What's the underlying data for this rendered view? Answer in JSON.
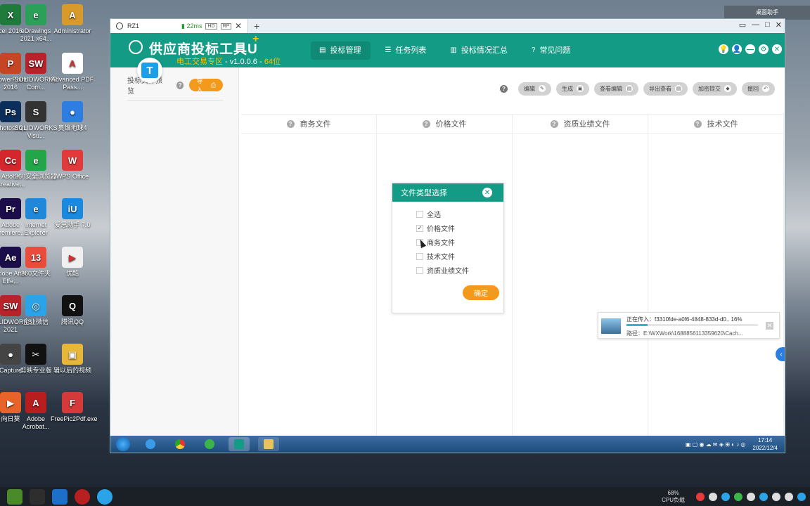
{
  "desktop": {
    "icons": [
      {
        "label": "cel 2016",
        "color": "#1e7b3c",
        "glyph": "X"
      },
      {
        "label": "eDrawings 2021 x64...",
        "color": "#2aa058",
        "glyph": "e"
      },
      {
        "label": "Administrator",
        "color": "#d89b2b",
        "glyph": "A"
      },
      {
        "label": "PowerPoint 2016",
        "color": "#c64524",
        "glyph": "P"
      },
      {
        "label": "SOLIDWORKS Com...",
        "color": "#b8222b",
        "glyph": "SW"
      },
      {
        "label": "Advanced PDF Pass...",
        "color": "#ffffff",
        "glyph": "A"
      },
      {
        "label": "Photoshop",
        "color": "#0b2e5b",
        "glyph": "Ps"
      },
      {
        "label": "SOLIDWORKS Visu...",
        "color": "#333333",
        "glyph": "S"
      },
      {
        "label": "奥维地球4",
        "color": "#2e7de0",
        "glyph": "●"
      },
      {
        "label": "Adobe Creative...",
        "color": "#d4262d",
        "glyph": "Cc"
      },
      {
        "label": "360安全浏览器",
        "color": "#23a54a",
        "glyph": "e"
      },
      {
        "label": "WPS Office",
        "color": "#e23a3a",
        "glyph": "W"
      },
      {
        "label": "Adobe Premiere...",
        "color": "#1b0d4a",
        "glyph": "Pr"
      },
      {
        "label": "Internet Explorer",
        "color": "#1f88d8",
        "glyph": "e"
      },
      {
        "label": "爱思助手 7.0",
        "color": "#1a8ae0",
        "glyph": "iU"
      },
      {
        "label": "Adobe After Effe...",
        "color": "#1b0d4a",
        "glyph": "Ae"
      },
      {
        "label": "360文件夹",
        "color": "#e94b3c",
        "glyph": "13"
      },
      {
        "label": "优酷",
        "color": "#f0f0f0",
        "glyph": "▶"
      },
      {
        "label": "SOLIDWORKS 2021",
        "color": "#b8222b",
        "glyph": "SW"
      },
      {
        "label": "企业微信",
        "color": "#2aa3e8",
        "glyph": "◎"
      },
      {
        "label": "腾讯QQ",
        "color": "#111111",
        "glyph": "Q"
      },
      {
        "label": "Capture",
        "color": "#444444",
        "glyph": "●"
      },
      {
        "label": "剪映专业版",
        "color": "#111111",
        "glyph": "✂"
      },
      {
        "label": "辑以后的视频",
        "color": "#e8b73a",
        "glyph": "▣"
      },
      {
        "label": "向日葵",
        "color": "#e8632a",
        "glyph": "▶"
      },
      {
        "label": "Adobe Acrobat...",
        "color": "#b81e1e",
        "glyph": "A"
      },
      {
        "label": "FreePic2Pdf.exe",
        "color": "#d43a3a",
        "glyph": "F"
      }
    ],
    "right_panel_label": "桌面助手"
  },
  "host_taskbar": {
    "cpu_percent": "68%",
    "cpu_label": "CPU负载"
  },
  "remote_window": {
    "tab_label": "RZ1",
    "latency": "22ms",
    "badge_hd": "HD",
    "badge_rp": "RP",
    "close_glyph": "✕",
    "plus_glyph": "+",
    "ctrls": [
      "▭",
      "—",
      "□",
      "✕"
    ]
  },
  "app": {
    "title": "供应商投标工具U",
    "title_plus": "+",
    "subtitle_zone": "电工交易专区",
    "subtitle_version": " - v1.0.0.6 - ",
    "subtitle_bits": "64位",
    "nav": [
      {
        "label": "投标管理",
        "icon": "▤"
      },
      {
        "label": "任务列表",
        "icon": "☰"
      },
      {
        "label": "投标情况汇总",
        "icon": "▥"
      },
      {
        "label": "常见问题",
        "icon": "?"
      }
    ],
    "header_icons": [
      "💡",
      "👤",
      "—",
      "⚙",
      "✕"
    ],
    "left_panel": {
      "label": "投标文件预览",
      "import_label": "导入"
    },
    "toolbar": {
      "buttons": [
        {
          "label": "编辑",
          "icon": "✎"
        },
        {
          "label": "生成",
          "icon": "▣"
        },
        {
          "label": "查看编辑",
          "icon": "▤"
        },
        {
          "label": "导出查看",
          "icon": "▤"
        },
        {
          "label": "加密提交",
          "icon": "◆"
        },
        {
          "label": "撤回",
          "icon": "↶"
        }
      ]
    },
    "columns": [
      "商务文件",
      "价格文件",
      "资质业绩文件",
      "技术文件"
    ],
    "dialog": {
      "title": "文件类型选择",
      "close_glyph": "✕",
      "options": [
        {
          "label": "全选",
          "checked": false
        },
        {
          "label": "价格文件",
          "checked": true
        },
        {
          "label": "商务文件",
          "checked": false
        },
        {
          "label": "技术文件",
          "checked": false
        },
        {
          "label": "资质业绩文件",
          "checked": false
        }
      ],
      "confirm_label": "确定"
    },
    "upload": {
      "line1": "正在传入：f3310fde-a0f6-4848-833d-d0.. 16%",
      "line2": "路径：E:\\WXWork\\1688856113359620\\Cach...",
      "progress_percent": 16,
      "close_glyph": "✕"
    }
  },
  "remote_taskbar": {
    "time": "17:14",
    "date": "2022/12/4"
  }
}
